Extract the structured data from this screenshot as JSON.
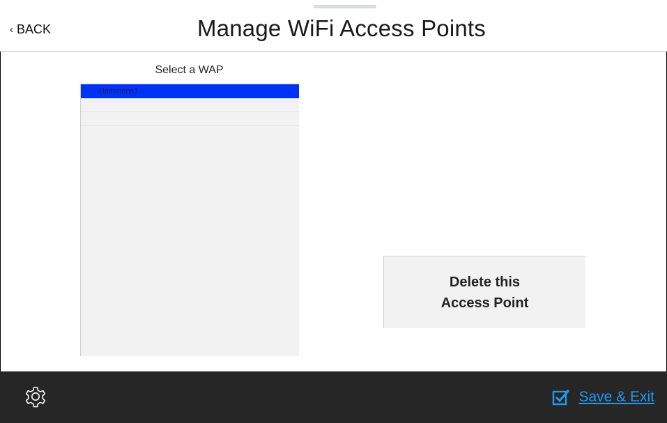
{
  "header": {
    "back_label": "BACK",
    "title": "Manage WiFi Access Points"
  },
  "wap_list": {
    "label": "Select a WAP",
    "items": [
      {
        "name": "Hammons1",
        "selected": true
      },
      {
        "name": "",
        "selected": false
      },
      {
        "name": "",
        "selected": false
      }
    ]
  },
  "actions": {
    "delete_line1": "Delete this",
    "delete_line2": "Access Point"
  },
  "footer": {
    "settings_icon": "gear-icon",
    "save_exit_label": "Save & Exit",
    "save_icon": "checkbox-checked-icon"
  },
  "colors": {
    "selected_row": "#0032f5",
    "footer_bg": "#262626",
    "accent": "#1d9bf0"
  }
}
